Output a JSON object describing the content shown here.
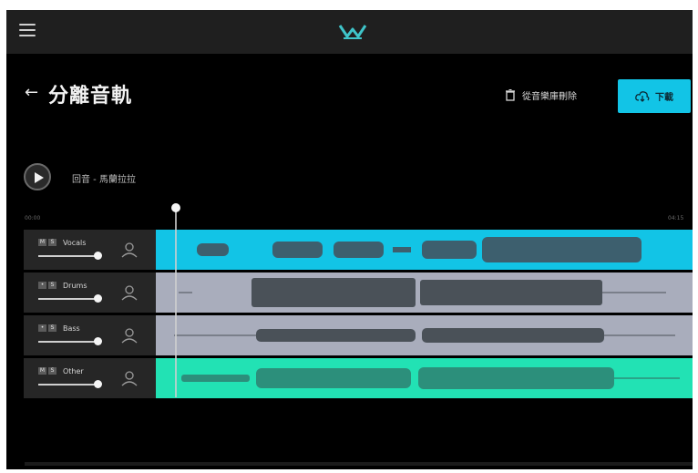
{
  "page": {
    "title": "分離音軌",
    "delete_label": "從音樂庫刪除",
    "download_label": "下載",
    "song_title": "回音 - 馬蘭拉拉",
    "time_start": "00:00",
    "time_end": "04:15"
  },
  "tracks": [
    {
      "name": "Vocals",
      "mute": "M",
      "solo": "S",
      "volume": 1.0,
      "color": "#12c4e6"
    },
    {
      "name": "Drums",
      "mute": "•",
      "solo": "S",
      "volume": 1.0,
      "color": "#a9adbc"
    },
    {
      "name": "Bass",
      "mute": "•",
      "solo": "S",
      "volume": 1.0,
      "color": "#a9adbc"
    },
    {
      "name": "Other",
      "mute": "M",
      "solo": "S",
      "volume": 1.0,
      "color": "#22e2b4"
    }
  ],
  "colors": {
    "accent": "#12c4e6",
    "vocals_lane": "#12c4e6",
    "drums_lane": "#a9adbc",
    "bass_lane": "#a9adbc",
    "other_lane": "#22e2b4",
    "waveform": "#4a5a66"
  },
  "icons": {
    "menu": "menu-icon",
    "logo": "app-logo-icon",
    "back": "back-arrow-icon",
    "delete": "trash-icon",
    "download": "cloud-download-icon",
    "play": "play-icon",
    "person": "person-icon"
  }
}
